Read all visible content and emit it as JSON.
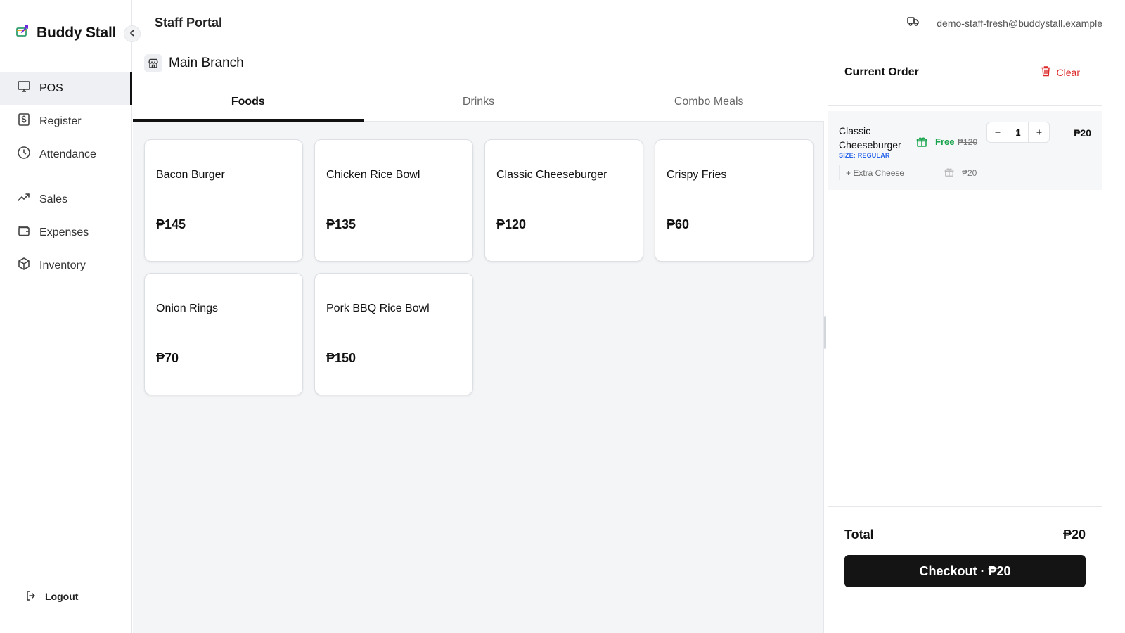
{
  "brand": {
    "name": "Buddy Stall"
  },
  "header": {
    "title": "Staff Portal",
    "user_email": "demo-staff-fresh@buddystall.example"
  },
  "sidebar": {
    "primary": [
      {
        "label": "POS",
        "icon": "monitor-icon",
        "active": true
      },
      {
        "label": "Register",
        "icon": "dollar-receipt-icon"
      },
      {
        "label": "Attendance",
        "icon": "clock-icon"
      }
    ],
    "secondary": [
      {
        "label": "Sales",
        "icon": "trending-up-icon"
      },
      {
        "label": "Expenses",
        "icon": "wallet-icon"
      },
      {
        "label": "Inventory",
        "icon": "box-icon"
      }
    ],
    "logout_label": "Logout"
  },
  "main": {
    "branch_name": "Main Branch",
    "tabs": [
      {
        "label": "Foods",
        "active": true
      },
      {
        "label": "Drinks"
      },
      {
        "label": "Combo Meals"
      }
    ],
    "products": [
      {
        "name": "Bacon Burger",
        "price": "₱145"
      },
      {
        "name": "Chicken Rice Bowl",
        "price": "₱135"
      },
      {
        "name": "Classic Cheeseburger",
        "price": "₱120"
      },
      {
        "name": "Crispy Fries",
        "price": "₱60"
      },
      {
        "name": "Onion Rings",
        "price": "₱70"
      },
      {
        "name": "Pork BBQ Rice Bowl",
        "price": "₱150"
      }
    ]
  },
  "order": {
    "title": "Current Order",
    "clear_label": "Clear",
    "items": [
      {
        "name": "Classic Cheeseburger",
        "size": "SIZE: REGULAR",
        "free_label": "Free",
        "original_price": "₱120",
        "quantity": "1",
        "line_total": "₱20",
        "addon": {
          "name": "+ Extra Cheese",
          "price": "₱20"
        }
      }
    ],
    "total_label": "Total",
    "total_value": "₱20",
    "checkout_label": "Checkout · ₱20"
  },
  "colors": {
    "accent": "#141414",
    "danger": "#dc2626",
    "success": "#16a34a",
    "info": "#2563eb"
  }
}
